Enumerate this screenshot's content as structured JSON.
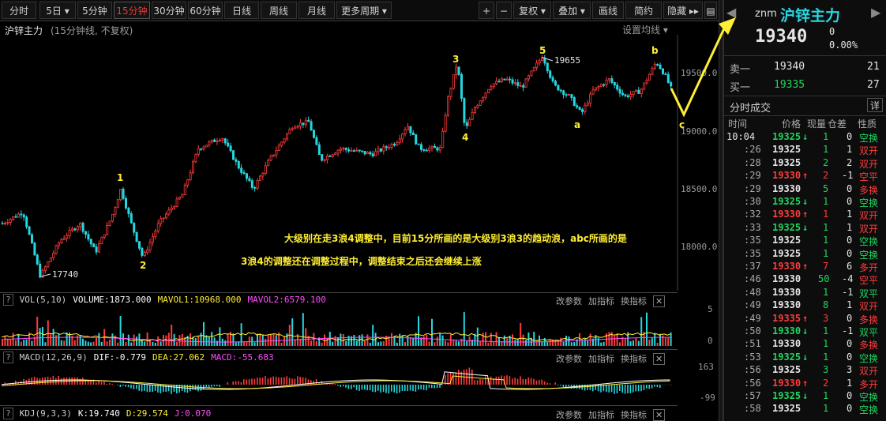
{
  "toolbar": {
    "tabs": [
      "分时",
      "5日 ▾",
      "5分钟",
      "15分钟",
      "30分钟",
      "60分钟",
      "日线",
      "周线",
      "月线",
      "更多周期 ▾"
    ],
    "active_tab": "15分钟",
    "right_buttons": [
      "+",
      "−",
      "复权 ▾",
      "叠加 ▾",
      "画线",
      "简约",
      "隐藏 ▸▸"
    ],
    "menu_icon": "▤"
  },
  "chart": {
    "title": "沪锌主力",
    "subtitle": "(15分钟线, 不复权)",
    "set_ma": "设置均线 ▾",
    "price_ticks": [
      "19500.0",
      "19000.0",
      "18500.0",
      "18000.0"
    ],
    "high_label": "19655",
    "low_label": "17740",
    "wave_labels": [
      "1",
      "2",
      "3",
      "4",
      "5",
      "a",
      "b",
      "c"
    ],
    "annotation_line1": "大级别在走3浪4调整中，目前15分所画的是大级别3浪3的趋动浪，abc所画的是",
    "annotation_line2": "3浪4的调整还在调整过程中，调整结束之后还会继续上涨"
  },
  "vol_panel": {
    "q": "?",
    "name": "VOL(5,10)",
    "volume": "VOLUME:1873.000",
    "ma1": "MAVOL1:10968.000",
    "ma2": "MAVOL2:6579.100",
    "ticks": [
      "5",
      "0"
    ],
    "actions": [
      "改参数",
      "加指标",
      "换指标"
    ],
    "close": "✕"
  },
  "macd_panel": {
    "q": "?",
    "name": "MACD(12,26,9)",
    "dif": "DIF:-0.779",
    "dea": "DEA:27.062",
    "macd": "MACD:-55.683",
    "ticks": [
      "163",
      "-99"
    ],
    "actions": [
      "改参数",
      "加指标",
      "换指标"
    ],
    "close": "✕"
  },
  "kdj_panel": {
    "q": "?",
    "name": "KDJ(9,3,3)",
    "k": "K:19.740",
    "d": "D:29.574",
    "j": "J:0.070",
    "actions": [
      "改参数",
      "加指标",
      "换指标"
    ],
    "close": "✕"
  },
  "quote": {
    "code": "znm",
    "name": "沪锌主力",
    "price": "19340",
    "change": "0",
    "change_pct": "0.00%",
    "sell_label": "卖一",
    "sell_price": "19340",
    "sell_vol": "21",
    "buy_label": "买一",
    "buy_price": "19335",
    "buy_vol": "27",
    "ticks_title": "分时成交",
    "detail_btn": "详",
    "col_time": "时间",
    "col_price": "价格",
    "col_vol": "现量",
    "col_oi": "仓差",
    "col_nature": "性质"
  },
  "trades": [
    {
      "t": "10:04",
      "p": "19325",
      "dir": "down",
      "v": "1",
      "oi": "0",
      "n": "空换"
    },
    {
      "t": ":26",
      "p": "19325",
      "dir": "",
      "v": "1",
      "oi": "1",
      "n": "双开"
    },
    {
      "t": ":28",
      "p": "19325",
      "dir": "",
      "v": "2",
      "oi": "2",
      "n": "双开"
    },
    {
      "t": ":29",
      "p": "19330",
      "dir": "up",
      "v": "2",
      "oi": "-1",
      "n": "空平"
    },
    {
      "t": ":29",
      "p": "19330",
      "dir": "",
      "v": "5",
      "oi": "0",
      "n": "多换"
    },
    {
      "t": ":30",
      "p": "19325",
      "dir": "down",
      "v": "1",
      "oi": "0",
      "n": "空换"
    },
    {
      "t": ":32",
      "p": "19330",
      "dir": "up",
      "v": "1",
      "oi": "1",
      "n": "双开"
    },
    {
      "t": ":33",
      "p": "19325",
      "dir": "down",
      "v": "1",
      "oi": "1",
      "n": "双开"
    },
    {
      "t": ":35",
      "p": "19325",
      "dir": "",
      "v": "1",
      "oi": "0",
      "n": "空换"
    },
    {
      "t": ":35",
      "p": "19325",
      "dir": "",
      "v": "1",
      "oi": "0",
      "n": "空换"
    },
    {
      "t": ":37",
      "p": "19330",
      "dir": "up",
      "v": "7",
      "oi": "6",
      "n": "多开"
    },
    {
      "t": ":46",
      "p": "19330",
      "dir": "",
      "v": "50",
      "oi": "-4",
      "n": "空平"
    },
    {
      "t": ":48",
      "p": "19330",
      "dir": "",
      "v": "1",
      "oi": "-1",
      "n": "双平"
    },
    {
      "t": ":49",
      "p": "19330",
      "dir": "",
      "v": "8",
      "oi": "1",
      "n": "双开"
    },
    {
      "t": ":49",
      "p": "19335",
      "dir": "up",
      "v": "3",
      "oi": "0",
      "n": "多换"
    },
    {
      "t": ":50",
      "p": "19330",
      "dir": "down",
      "v": "1",
      "oi": "-1",
      "n": "双平"
    },
    {
      "t": ":51",
      "p": "19330",
      "dir": "",
      "v": "1",
      "oi": "0",
      "n": "多换"
    },
    {
      "t": ":53",
      "p": "19325",
      "dir": "down",
      "v": "1",
      "oi": "0",
      "n": "空换"
    },
    {
      "t": ":56",
      "p": "19325",
      "dir": "",
      "v": "3",
      "oi": "3",
      "n": "双开"
    },
    {
      "t": ":56",
      "p": "19330",
      "dir": "up",
      "v": "2",
      "oi": "1",
      "n": "多开"
    },
    {
      "t": ":57",
      "p": "19325",
      "dir": "down",
      "v": "1",
      "oi": "0",
      "n": "空换"
    },
    {
      "t": ":58",
      "p": "19325",
      "dir": "",
      "v": "1",
      "oi": "0",
      "n": "空换"
    }
  ],
  "colors": {
    "up": "#ff3b3b",
    "down": "#1fd65f",
    "accent": "#ffee33",
    "cyan": "#26d7e0"
  }
}
